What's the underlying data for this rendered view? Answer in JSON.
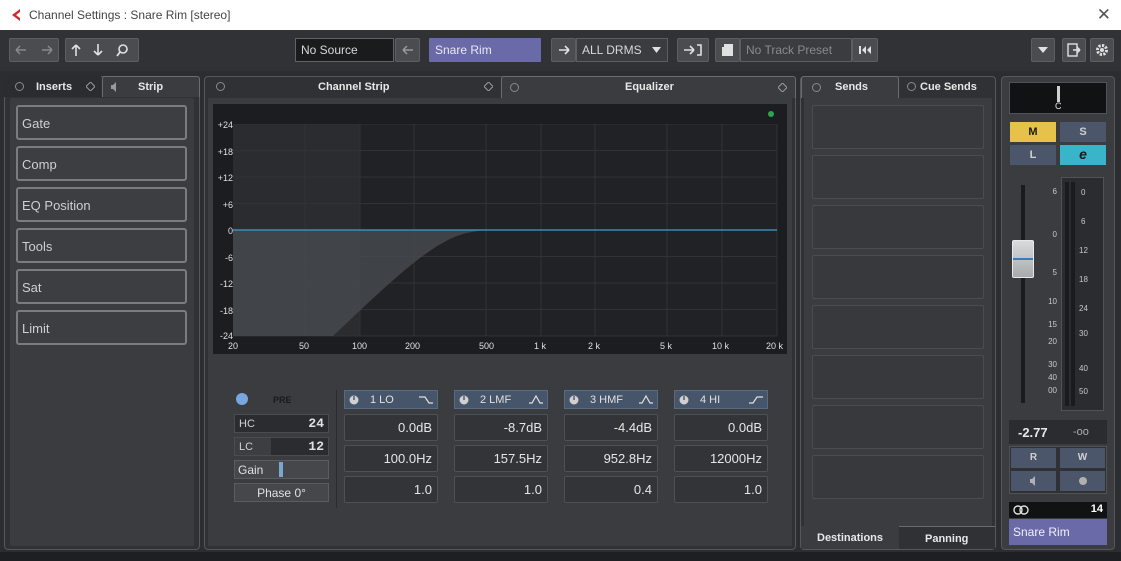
{
  "window": {
    "title": "Channel Settings : Snare Rim [stereo]",
    "close_glyph": "✕"
  },
  "toolbar": {
    "source_label": "No Source",
    "track_name": "Snare Rim",
    "visibility_label": "ALL DRMS",
    "preset_placeholder": "No Track Preset"
  },
  "left_panel": {
    "tabs": [
      {
        "label": "Inserts"
      },
      {
        "label": "Strip"
      }
    ],
    "slots": [
      "Gate",
      "Comp",
      "EQ Position",
      "Tools",
      "Sat",
      "Limit"
    ]
  },
  "center_panel": {
    "tabs": [
      {
        "label": "Channel Strip"
      },
      {
        "label": "Equalizer"
      }
    ]
  },
  "eq_graph": {
    "y_ticks": [
      "+24",
      "+18",
      "+12",
      "+6",
      "0",
      "-6",
      "-12",
      "-18",
      "-24"
    ],
    "x_ticks": [
      "20",
      "50",
      "100",
      "200",
      "500",
      "1 k",
      "2 k",
      "5 k",
      "10 k",
      "20 k"
    ]
  },
  "eq_controls": {
    "pre_label": "PRE",
    "hc_label": "HC",
    "hc_value": "24",
    "lc_label": "LC",
    "lc_value": "12",
    "gain_label": "Gain",
    "phase_label": "Phase 0°"
  },
  "bands": [
    {
      "name": "1 LO",
      "gain": "0.0dB",
      "freq": "100.0Hz",
      "q": "1.0"
    },
    {
      "name": "2 LMF",
      "gain": "-8.7dB",
      "freq": "157.5Hz",
      "q": "1.0"
    },
    {
      "name": "3 HMF",
      "gain": "-4.4dB",
      "freq": "952.8Hz",
      "q": "0.4"
    },
    {
      "name": "4 HI",
      "gain": "0.0dB",
      "freq": "12000Hz",
      "q": "1.0"
    }
  ],
  "sends_panel": {
    "tabs": [
      {
        "label": "Sends"
      },
      {
        "label": "Cue Sends"
      }
    ],
    "bottom_tabs": [
      {
        "label": "Destinations"
      },
      {
        "label": "Panning"
      }
    ]
  },
  "fader": {
    "pan_label": "C",
    "m_label": "M",
    "s_label": "S",
    "l_label": "L",
    "e_label": "e",
    "left_scale": [
      "6",
      "0",
      "5",
      "10",
      "15",
      "20",
      "30",
      "40",
      "00"
    ],
    "right_scale": [
      "0",
      "6",
      "12",
      "18",
      "24",
      "30",
      "40",
      "50"
    ],
    "volume": "-2.77",
    "peak": "-oo",
    "r_label": "R",
    "w_label": "W",
    "channel_number": "14",
    "channel_name": "Snare Rim"
  },
  "colors": {
    "accent_blue": "#3d9fcc",
    "m_yellow": "#e6c24a",
    "e_cyan": "#3ab4c8",
    "track_purple": "#6a6aa8"
  }
}
